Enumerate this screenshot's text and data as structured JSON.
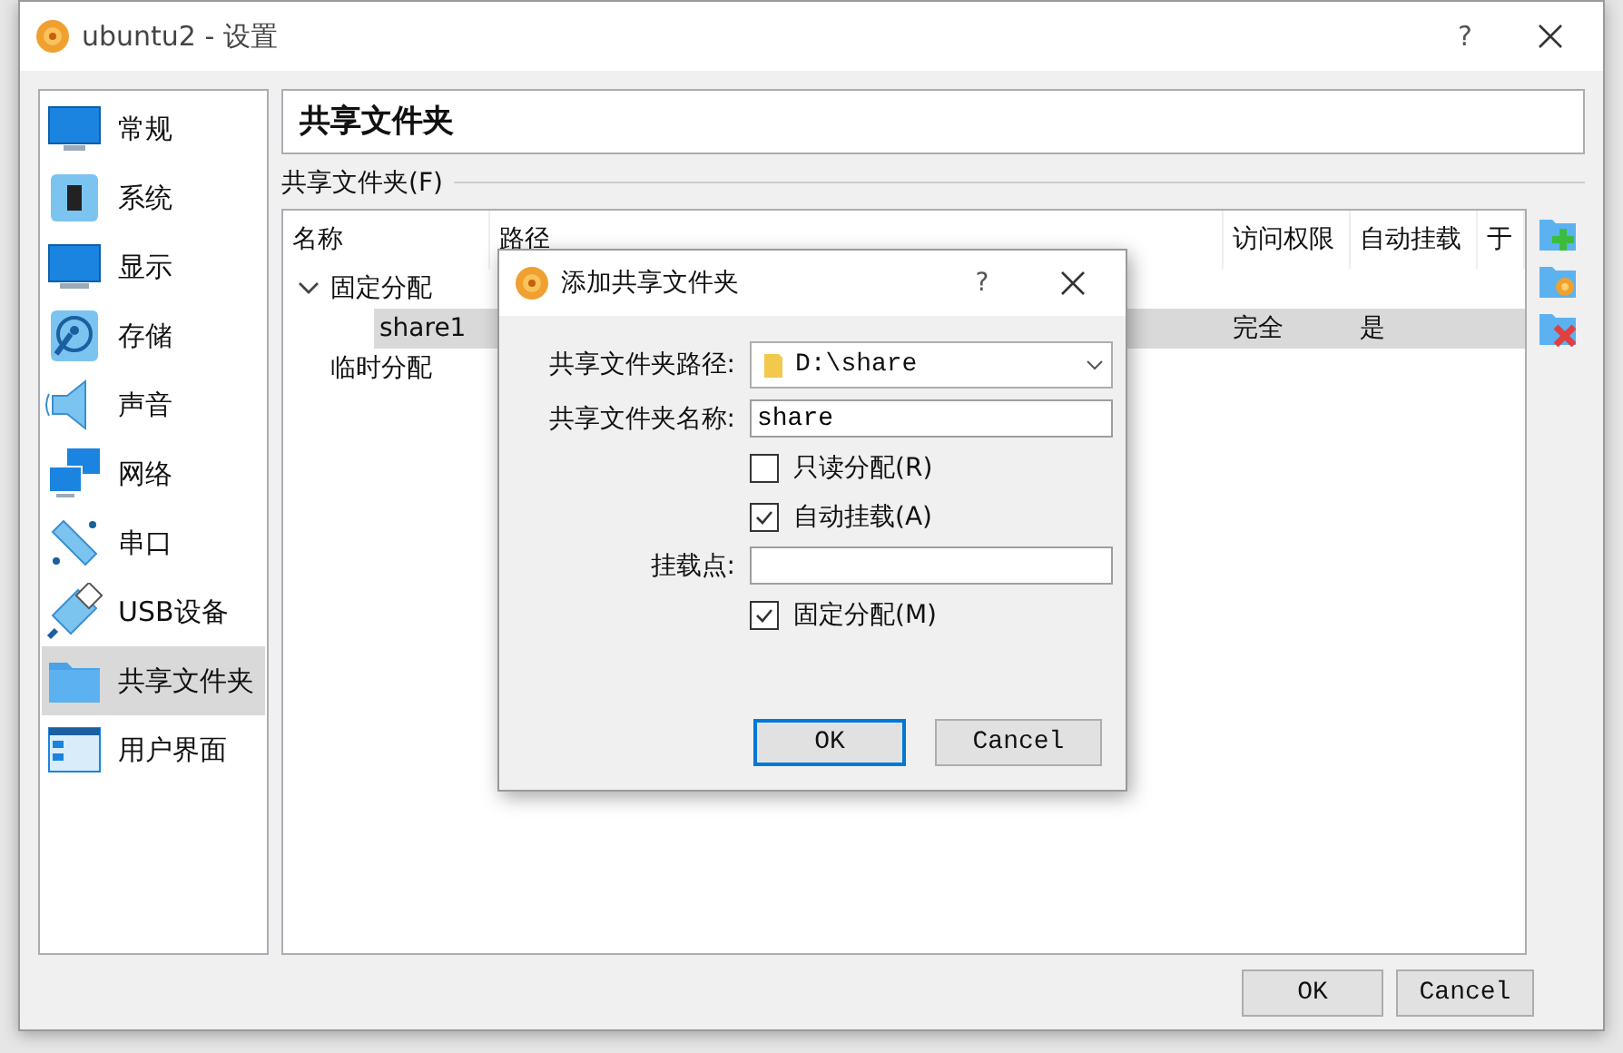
{
  "window": {
    "title": "ubuntu2 - 设置",
    "help": "?"
  },
  "sidebar": {
    "items": [
      {
        "label": "常规",
        "selected": false
      },
      {
        "label": "系统",
        "selected": false
      },
      {
        "label": "显示",
        "selected": false
      },
      {
        "label": "存储",
        "selected": false
      },
      {
        "label": "声音",
        "selected": false
      },
      {
        "label": "网络",
        "selected": false
      },
      {
        "label": "串口",
        "selected": false
      },
      {
        "label": "USB设备",
        "selected": false
      },
      {
        "label": "共享文件夹",
        "selected": true
      },
      {
        "label": "用户界面",
        "selected": false
      }
    ]
  },
  "page": {
    "title": "共享文件夹",
    "group_label": "共享文件夹(F)"
  },
  "table": {
    "columns": [
      "名称",
      "路径",
      "访问权限",
      "自动挂载",
      "于"
    ],
    "rows": [
      {
        "label": "固定分配",
        "expanded": true,
        "children": [
          {
            "name": "share1",
            "access": "完全",
            "auto_mount": "是",
            "selected": true
          }
        ]
      },
      {
        "label": "临时分配",
        "children": []
      }
    ]
  },
  "buttons": [
    {
      "label": "OK"
    },
    {
      "label": "Cancel"
    }
  ],
  "dialog": {
    "title": "添加共享文件夹",
    "help": "?",
    "fields": [
      {
        "kind": "combo",
        "label": "共享文件夹路径:",
        "value": "D:\\share"
      },
      {
        "kind": "text",
        "label": "共享文件夹名称:",
        "value": "share"
      },
      {
        "kind": "checkbox",
        "label": "只读分配(R)",
        "checked": false
      },
      {
        "kind": "checkbox",
        "label": "自动挂载(A)",
        "checked": true
      },
      {
        "kind": "text",
        "label": "挂载点:"
      },
      {
        "kind": "checkbox",
        "label": "固定分配(M)",
        "checked": true
      }
    ],
    "buttons": [
      {
        "label": "OK",
        "default": true
      },
      {
        "label": "Cancel",
        "default": false
      }
    ]
  }
}
